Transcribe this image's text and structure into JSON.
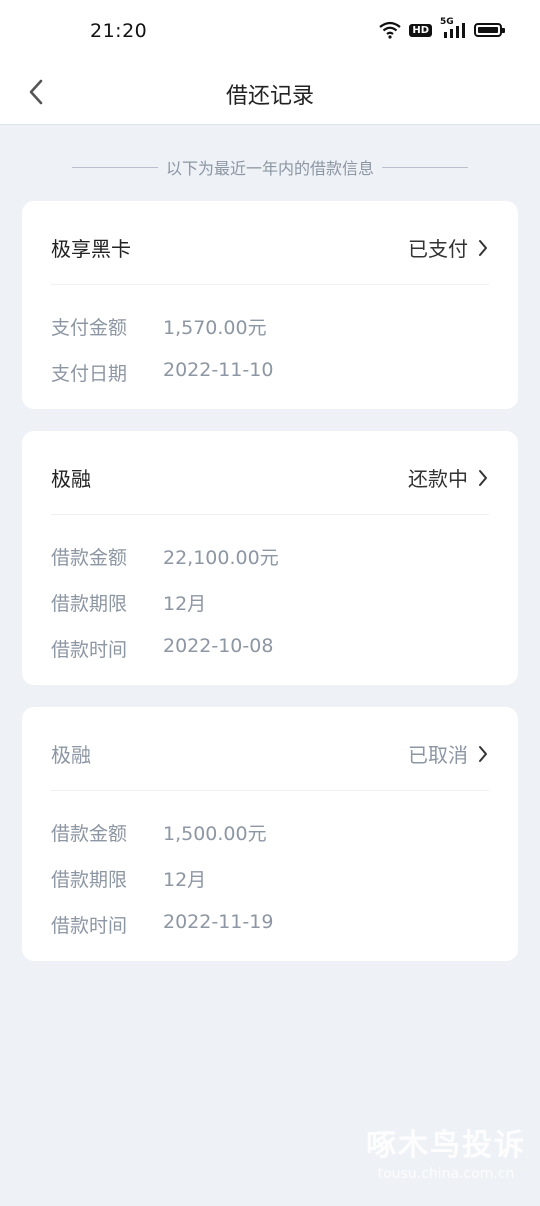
{
  "status_bar": {
    "time": "21:20",
    "hd_label": "HD",
    "net_label": "5G"
  },
  "nav": {
    "title": "借还记录"
  },
  "notice": "以下为最近一年内的借款信息",
  "cards": [
    {
      "title": "极享黑卡",
      "status": "已支付",
      "rows": [
        {
          "label": "支付金额",
          "value": "1,570.00元"
        },
        {
          "label": "支付日期",
          "value": "2022-11-10"
        }
      ]
    },
    {
      "title": "极融",
      "status": "还款中",
      "rows": [
        {
          "label": "借款金额",
          "value": "22,100.00元"
        },
        {
          "label": "借款期限",
          "value": "12月"
        },
        {
          "label": "借款时间",
          "value": "2022-10-08"
        }
      ]
    },
    {
      "title": "极融",
      "status": "已取消",
      "rows": [
        {
          "label": "借款金额",
          "value": "1,500.00元"
        },
        {
          "label": "借款期限",
          "value": "12月"
        },
        {
          "label": "借款时间",
          "value": "2022-11-19"
        }
      ]
    }
  ],
  "watermark": {
    "brand": "啄木鸟投诉",
    "domain": "tousu.china.com.cn"
  }
}
